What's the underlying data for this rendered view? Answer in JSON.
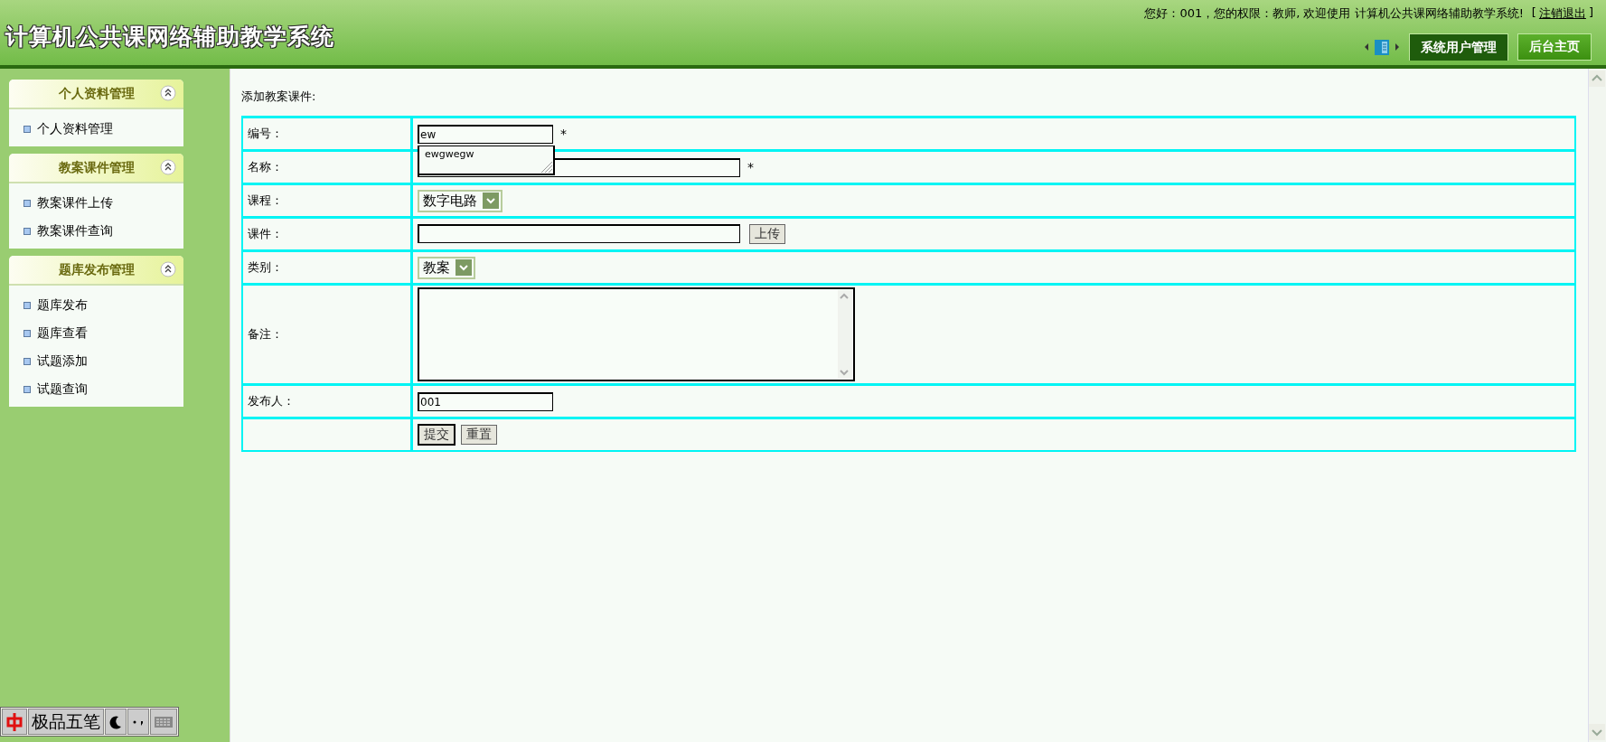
{
  "header": {
    "title": "计算机公共课网络辅助教学系统",
    "greeting": "您好：001，您的权限：教师, 欢迎使用  计算机公共课网络辅助教学系统!",
    "logout_open": "[",
    "logout_link": "注销退出",
    "logout_close": "]",
    "tabs": [
      {
        "label": "系统用户管理",
        "selected": true
      },
      {
        "label": "后台主页",
        "selected": false
      }
    ]
  },
  "sidebar": {
    "groups": [
      {
        "title": "个人资料管理",
        "expanded": true,
        "items": [
          "个人资料管理"
        ]
      },
      {
        "title": "教案课件管理",
        "expanded": true,
        "items": [
          "教案课件上传",
          "教案课件查询"
        ]
      },
      {
        "title": "题库发布管理",
        "expanded": true,
        "items": [
          "题库发布",
          "题库查看",
          "试题添加",
          "试题查询"
        ]
      }
    ]
  },
  "form": {
    "heading": "添加教案课件:",
    "rows": [
      {
        "kind": "text",
        "label": "编号：",
        "value": "ew",
        "required_mark": "*",
        "wide": false,
        "suggestions": [
          "ewgwegw"
        ]
      },
      {
        "kind": "text",
        "label": "名称：",
        "required_mark": "*",
        "wide": true
      },
      {
        "kind": "select",
        "label": "课程：",
        "value": "数字电路"
      },
      {
        "kind": "file",
        "label": "课件：",
        "button": "上传"
      },
      {
        "kind": "select",
        "label": "类别：",
        "value": "教案"
      },
      {
        "kind": "textarea",
        "label": "备注："
      },
      {
        "kind": "text",
        "label": "发布人：",
        "value": "001",
        "wide": false
      },
      {
        "kind": "buttons",
        "buttons": [
          "提交",
          "重置"
        ]
      }
    ]
  },
  "ime_bar": {
    "label": "极品五笔"
  }
}
